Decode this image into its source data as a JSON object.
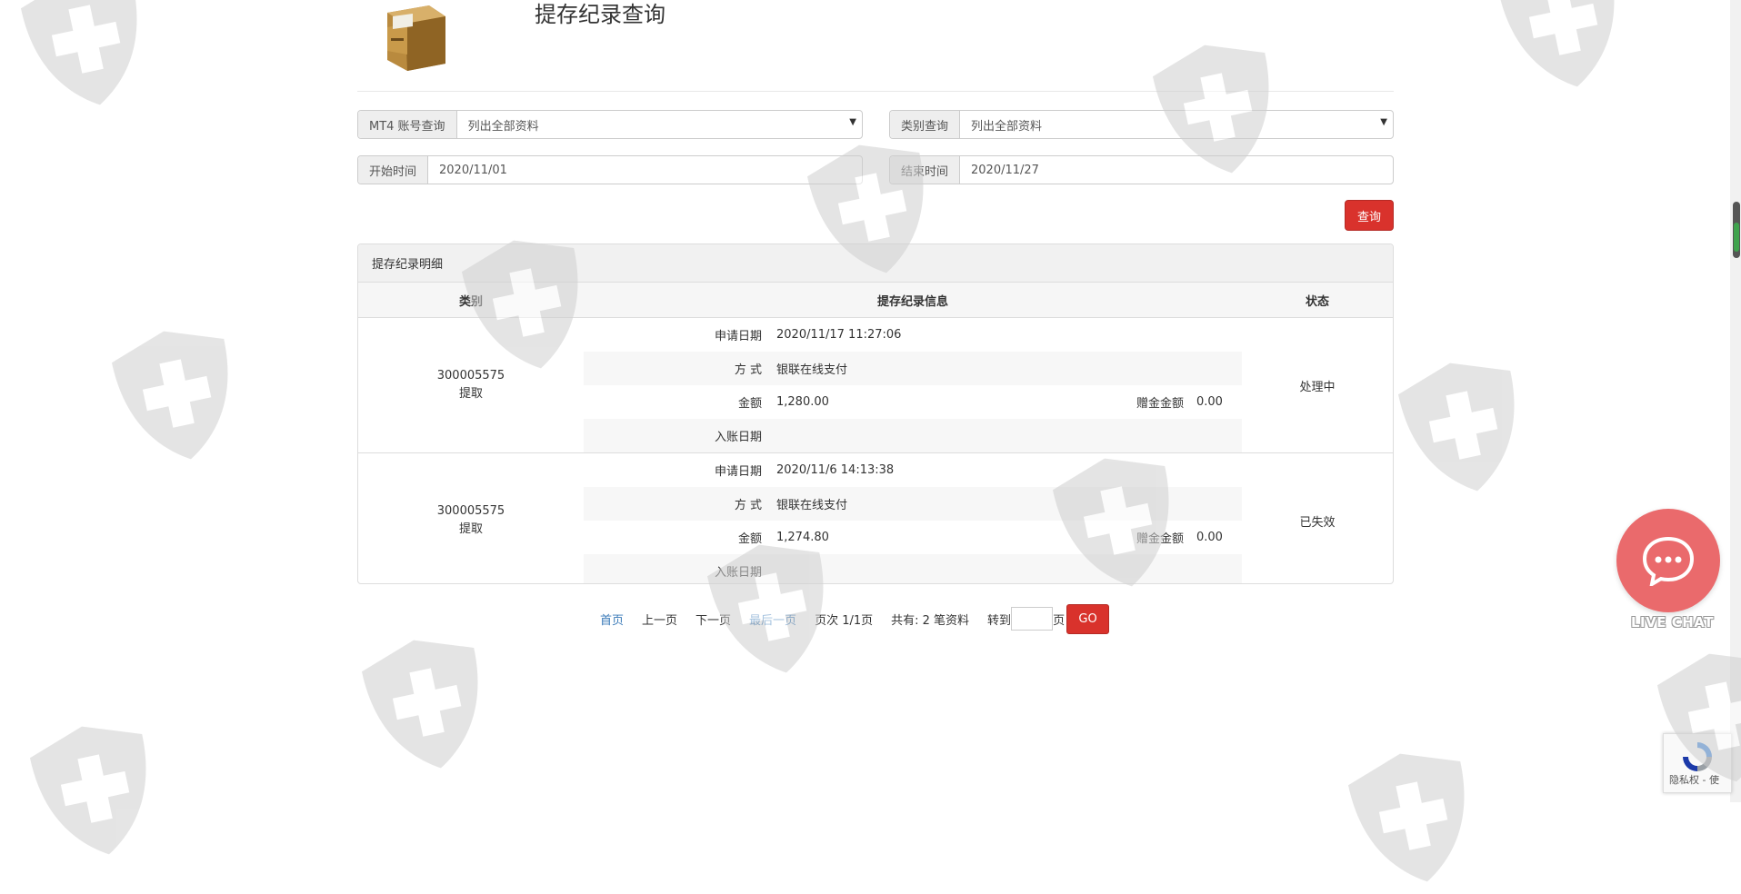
{
  "header": {
    "title": "提存纪录查询",
    "icon": "file-cabinet-icon"
  },
  "filters": {
    "account": {
      "label": "MT4 账号查询",
      "value": "列出全部资料"
    },
    "category": {
      "label": "类别查询",
      "value": "列出全部资料"
    },
    "start": {
      "label": "开始时间",
      "value": "2020/11/01"
    },
    "end": {
      "label": "结束时间",
      "value": "2020/11/27"
    },
    "query_button": "查询"
  },
  "panel": {
    "title": "提存纪录明细",
    "columns": [
      "类别",
      "提存纪录信息",
      "状态"
    ],
    "records": [
      {
        "account": "300005575",
        "type": "提取",
        "apply_date_label": "申请日期",
        "apply_date": "2020/11/17 11:27:06",
        "method_label": "方 式",
        "method": "银联在线支付",
        "amount_label": "金额",
        "amount": "1,280.00",
        "bonus_label": "赠金金额",
        "bonus": "0.00",
        "posting_date_label": "入账日期",
        "posting_date": "",
        "status": "处理中"
      },
      {
        "account": "300005575",
        "type": "提取",
        "apply_date_label": "申请日期",
        "apply_date": "2020/11/6 14:13:38",
        "method_label": "方 式",
        "method": "银联在线支付",
        "amount_label": "金额",
        "amount": "1,274.80",
        "bonus_label": "赠金金额",
        "bonus": "0.00",
        "posting_date_label": "入账日期",
        "posting_date": "",
        "status": "已失效"
      }
    ]
  },
  "pagination": {
    "first": "首页",
    "prev": "上一页",
    "next": "下一页",
    "last": "最后一页",
    "page_info": "页次 1/1页",
    "total": "共有: 2 笔资料",
    "goto_label": "转到",
    "page_suffix": "页",
    "goto_value": "",
    "go_button": "GO"
  },
  "livechat": {
    "label": "LIVE CHAT"
  },
  "recaptcha": {
    "text": "隐私权 - 使"
  },
  "colors": {
    "accent": "#d9322c",
    "link": "#3a7ab8",
    "livechat": "#ea6a6c"
  }
}
